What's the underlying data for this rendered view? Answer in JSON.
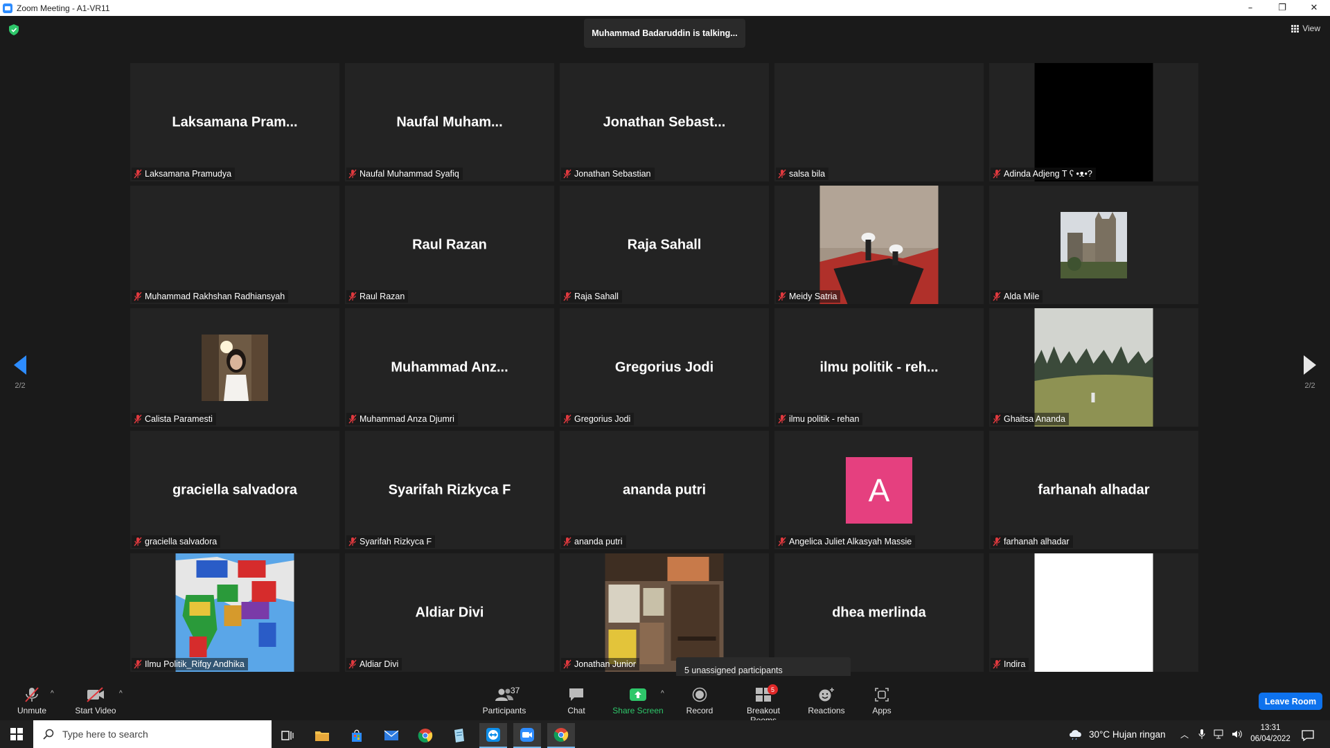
{
  "window": {
    "title": "Zoom Meeting - A1-VR11",
    "minimize": "–",
    "restore": "❐",
    "close": "✕"
  },
  "meeting": {
    "talking": "Muhammad Badaruddin is talking...",
    "view_label": "View",
    "page_left": "2/2",
    "page_right": "2/2",
    "tooltip": "5 unassigned participants"
  },
  "tiles": [
    {
      "big": "Laksamana  Pram...",
      "name": "Laksamana Pramudya"
    },
    {
      "big": "Naufal  Muham...",
      "name": "Naufal Muhammad Syafiq"
    },
    {
      "big": "Jonathan  Sebast...",
      "name": "Jonathan Sebastian"
    },
    {
      "big": "",
      "name": "salsa bila"
    },
    {
      "big": "",
      "name": "Adinda Adjeng T ʕ •ᴥ•?"
    },
    {
      "big": "",
      "name": "Muhammad Rakhshan Radhiansyah"
    },
    {
      "big": "Raul Razan",
      "name": "Raul Razan"
    },
    {
      "big": "Raja Sahall",
      "name": "Raja Sahall"
    },
    {
      "big": "",
      "name": "Meidy Satria"
    },
    {
      "big": "",
      "name": "Alda Mile"
    },
    {
      "big": "",
      "name": "Calista Paramesti"
    },
    {
      "big": "Muhammad  Anz...",
      "name": "Muhammad Anza Djumri"
    },
    {
      "big": "Gregorius Jodi",
      "name": "Gregorius Jodi"
    },
    {
      "big": "ilmu politik - reh...",
      "name": "ilmu politik - rehan"
    },
    {
      "big": "",
      "name": "Ghaitsa Ananda"
    },
    {
      "big": "graciella salvadora",
      "name": "graciella salvadora"
    },
    {
      "big": "Syarifah Rizkyca F",
      "name": "Syarifah Rizkyca F"
    },
    {
      "big": "ananda putri",
      "name": "ananda putri"
    },
    {
      "big": "",
      "name": "Angelica Juliet Alkasyah Massie",
      "avatar_letter": "A"
    },
    {
      "big": "farhanah alhadar",
      "name": "farhanah alhadar"
    },
    {
      "big": "",
      "name": "Ilmu Politik_Rifqy Andhika"
    },
    {
      "big": "Aldiar Divi",
      "name": "Aldiar Divi"
    },
    {
      "big": "",
      "name": "Jonathan Junior"
    },
    {
      "big": "dhea merlinda",
      "name": ""
    },
    {
      "big": "",
      "name": "Indira"
    }
  ],
  "toolbar": {
    "unmute": "Unmute",
    "start_video": "Start Video",
    "participants": "Participants",
    "participants_count": "37",
    "chat": "Chat",
    "share_screen": "Share Screen",
    "record": "Record",
    "breakout_rooms": "Breakout Rooms",
    "breakout_badge": "5",
    "reactions": "Reactions",
    "apps": "Apps",
    "leave_room": "Leave Room"
  },
  "taskbar": {
    "search_placeholder": "Type here to search",
    "weather": "30°C  Hujan ringan",
    "time": "13:31",
    "date": "06/04/2022"
  },
  "colors": {
    "accent": "#0e72ed",
    "avatar_bg": "#e5407f",
    "share_green": "#2ec76a",
    "muted_red": "#e0393e"
  }
}
